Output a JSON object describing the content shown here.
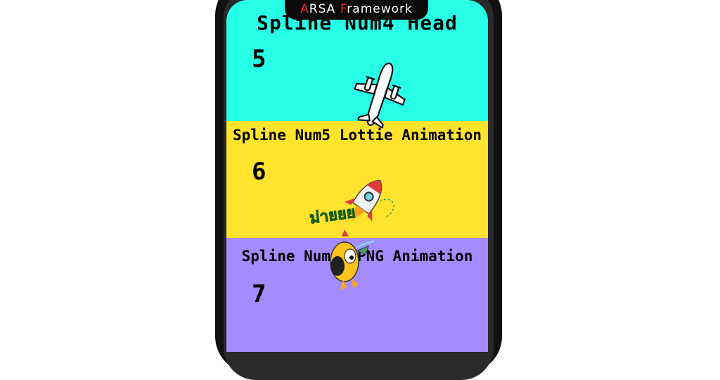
{
  "header": {
    "brand_first_letter": "A",
    "brand_first_rest": "RSA",
    "brand_second_letter": "F",
    "brand_second_rest": "ramework"
  },
  "panels": [
    {
      "title": "Spline Num4 Head",
      "number": "5",
      "color": "#27ffe7"
    },
    {
      "title": "Spline Num5 Lottie Animation",
      "number": "6",
      "color": "#ffe32c"
    },
    {
      "title": "Spline Num6 APNG Animation",
      "number": "7",
      "color": "#a48cff"
    }
  ],
  "sticker": {
    "text": "ม่ายยย"
  },
  "colors": {
    "brand_accent": "#ff2020",
    "phone_frame": "#111111"
  },
  "icons": [
    "airplane-icon",
    "rocket-icon",
    "chicken-sticker"
  ]
}
